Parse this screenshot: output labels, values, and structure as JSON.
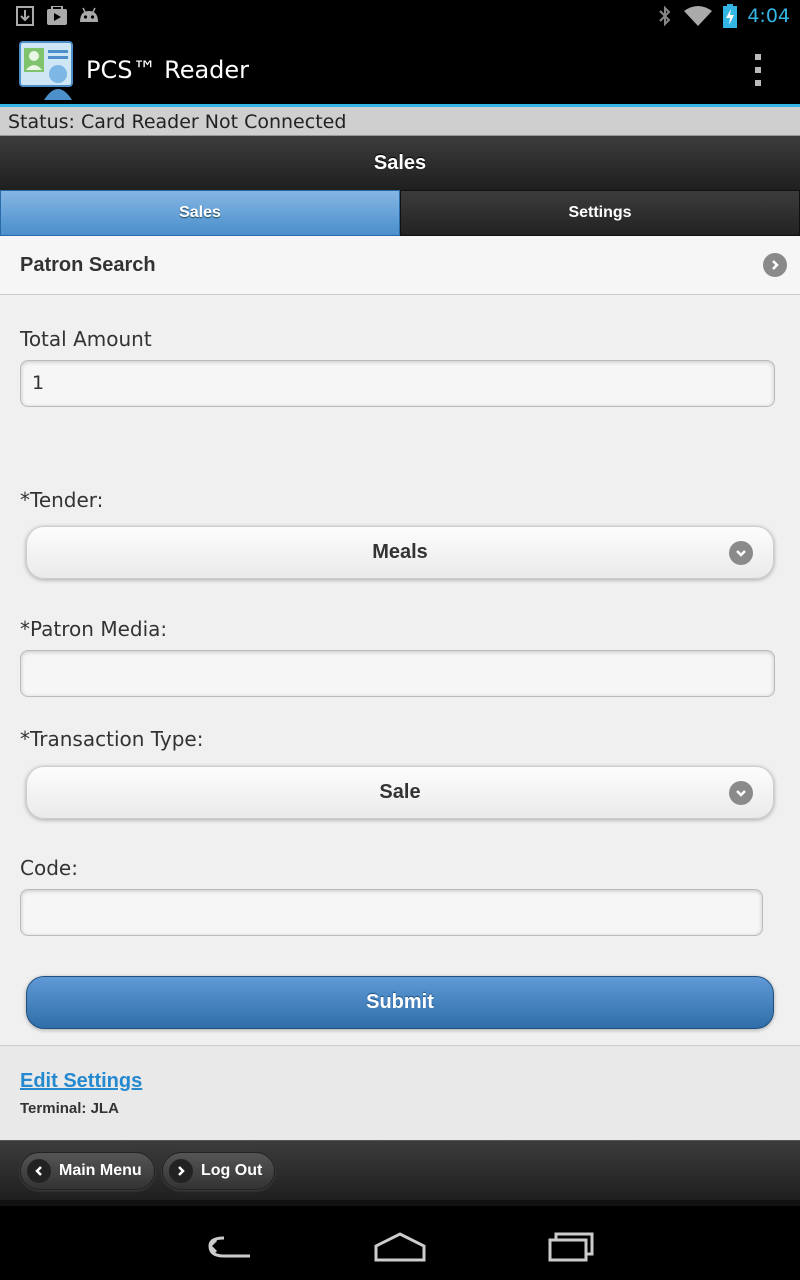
{
  "status_bar": {
    "time": "4:04",
    "icons": [
      "download-icon",
      "play-store-icon",
      "android-icon",
      "bluetooth-icon",
      "wifi-icon",
      "battery-charging-icon"
    ]
  },
  "action_bar": {
    "app_title": "PCS™ Reader",
    "app_icon": "pcs-reader-icon",
    "overflow_icon": "overflow-menu-icon"
  },
  "app": {
    "status_text": "Status: Card Reader Not Connected",
    "page_header": "Sales",
    "tabs": [
      {
        "label": "Sales",
        "active": true
      },
      {
        "label": "Settings",
        "active": false
      }
    ],
    "patron_search": {
      "label": "Patron Search",
      "icon": "chevron-right-icon"
    },
    "form": {
      "total_amount": {
        "label": "Total Amount",
        "value": "1"
      },
      "tender": {
        "label": "*Tender:",
        "selected": "Meals"
      },
      "patron_media": {
        "label": "*Patron Media:",
        "value": ""
      },
      "transaction_type": {
        "label": "*Transaction Type:",
        "selected": "Sale"
      },
      "code": {
        "label": "Code:",
        "value": ""
      },
      "submit_label": "Submit"
    },
    "footer": {
      "edit_settings": "Edit Settings",
      "terminal": "Terminal: JLA"
    },
    "bottom_nav": {
      "main_menu": "Main Menu",
      "log_out": "Log Out"
    }
  },
  "colors": {
    "accent": "#33b5e5",
    "active_tab": "#5f9ad6",
    "link": "#2489ce",
    "submit": "#2f6ea8"
  }
}
